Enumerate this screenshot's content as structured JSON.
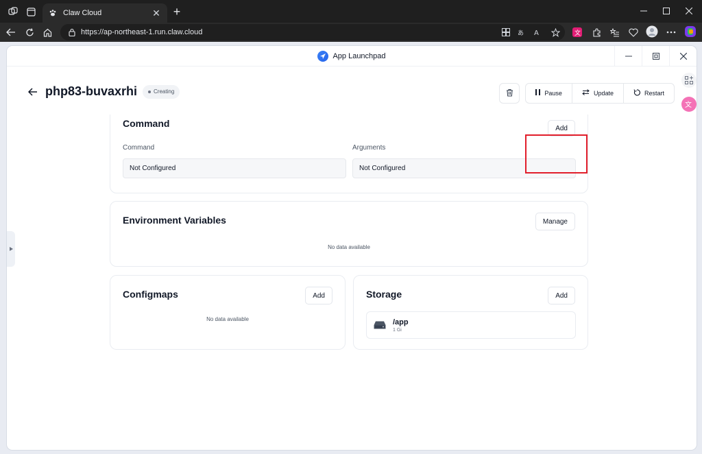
{
  "browser": {
    "tab_title": "Claw Cloud",
    "url": "https://ap-northeast-1.run.claw.cloud",
    "tab_close_glyph": "✕",
    "new_tab_glyph": "+"
  },
  "app": {
    "window_title": "App Launchpad",
    "name": "php83-buvaxrhi",
    "status": "Creating",
    "actions": {
      "pause": "Pause",
      "update": "Update",
      "restart": "Restart"
    }
  },
  "command_section": {
    "title": "Command",
    "add_label": "Add",
    "command_label": "Command",
    "arguments_label": "Arguments",
    "command_value": "Not Configured",
    "arguments_value": "Not Configured"
  },
  "env_section": {
    "title": "Environment Variables",
    "manage_label": "Manage",
    "empty_text": "No data available"
  },
  "configmaps_section": {
    "title": "Configmaps",
    "add_label": "Add",
    "empty_text": "No data available"
  },
  "storage_section": {
    "title": "Storage",
    "add_label": "Add",
    "items": [
      {
        "path": "/app",
        "size": "1 Gi"
      }
    ]
  },
  "colors": {
    "highlight": "#e11d2a",
    "accent": "#2563eb"
  }
}
